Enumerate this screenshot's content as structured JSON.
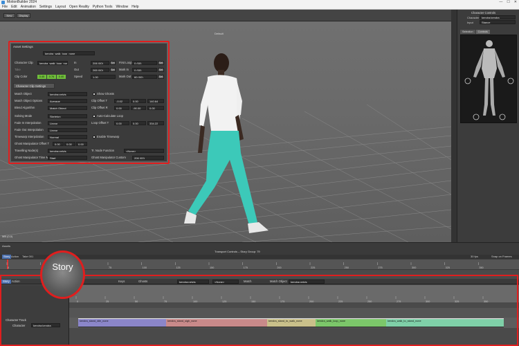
{
  "window": {
    "title": "MotionBuilder 2024",
    "controls": [
      "—",
      "☐",
      "✕"
    ]
  },
  "menu": [
    "File",
    "Edit",
    "Animation",
    "Settings",
    "Layout",
    "Open Reality",
    "Python Tools",
    "Window",
    "Help"
  ],
  "toolbar": {
    "btn1": "New",
    "btn2": "Display"
  },
  "viewport": {
    "label": "Default",
    "bottom_label": "MB (0,0)"
  },
  "asset_settings": {
    "title": "Asset Settings",
    "clip_name": "kendra_walk_loop_none",
    "character_clip_label": "Character Clip",
    "character_clip_value": "kendra_walk_loop_none",
    "in_label": "In",
    "in_value": "206 (00)",
    "out_label": "Out",
    "out_value": "265 (00)",
    "first_loop_label": "First Loop",
    "first_loop_value": "0 (00)",
    "mark_in_label": "Mark In",
    "mark_in_value": "0 (00)",
    "mark_out_label": "Mark Out",
    "mark_out_value": "60 (00)",
    "speed_label": "Speed",
    "speed_value": "1.00",
    "set_label": "Set",
    "take_label": "Take",
    "clip_color_label": "Clip Color",
    "clip_color_values": [
      "0.45",
      "0.76",
      "0.40"
    ],
    "section_tab": "Character Clip Settings",
    "match_object_label": "Match Object",
    "match_object_value": "kendra:pelvis",
    "show_ghosts_label": "Show Ghosts",
    "match_object_options_label": "Match Object Options",
    "match_object_options_value": "Average",
    "clip_offset_t_label": "Clip Offset T",
    "clip_offset_t_values": [
      "-0.02",
      "0.00",
      "140.64"
    ],
    "blend_algorithm_label": "Blend Algorithm",
    "blend_algorithm_value": "Match Object",
    "clip_offset_r_label": "Clip Offset R",
    "clip_offset_r_values": [
      "0.00",
      "-90.00",
      "0.00"
    ],
    "solving_mode_label": "Solving Mode",
    "solving_mode_value": "Skeleton",
    "auto_calc_loop_label": "Auto-Calculate Loop",
    "fade_in_label": "Fade In Interpolation",
    "fade_in_value": "Linear",
    "loop_offset_t_label": "Loop Offset T",
    "loop_offset_t_values": [
      "0.00",
      "0.00",
      "334.22"
    ],
    "fade_out_label": "Fade Out Interpolation",
    "fade_out_value": "Linear",
    "timewarp_label": "Timewarp Interpolation",
    "timewarp_value": "Normal",
    "enable_timewarp_label": "Enable Timewarp",
    "ghost_offset_label": "Ghost Manipulator Offset T",
    "ghost_offset_values": [
      "0.00",
      "0.00",
      "0.00"
    ],
    "travelling_node_label": "Travelling Node(s)",
    "travelling_node_value": "kendra:pelvis",
    "tr_node_function_label": "Tr. Node Function",
    "tr_node_function_value": "<None>",
    "ghost_time_label": "Ghost Manipulator Time Mc",
    "ghost_time_value": "Start",
    "ghost_custom_label": "Ghost Manipulator Custom",
    "ghost_custom_value": "206 (00)"
  },
  "right_panel": {
    "title": "Character Controls",
    "character_label": "Character",
    "character_value": "kendra:kendra",
    "input_label": "Input",
    "input_value": "Stance",
    "tabs": [
      "Selection",
      "Controls"
    ]
  },
  "transport": {
    "title": "Transport Controls – Story Group: 79",
    "fps": "30 fps",
    "snap_label": "Snap on Frames",
    "tabs": [
      "Story",
      "Action",
      "Take 001"
    ],
    "frame_ticks": [
      "0",
      "25",
      "50",
      "75",
      "100",
      "125",
      "150",
      "175",
      "200",
      "225",
      "250",
      "275",
      "300",
      "325",
      "350"
    ]
  },
  "story": {
    "callout": "Story",
    "tabs": [
      "Story",
      "Action"
    ],
    "keys_label": "Keys",
    "ghosts_label": "Ghosts",
    "object_value": "kendra:pelvis",
    "none_value": "<None>",
    "match_label": "Match",
    "match_object_label": "Match Object",
    "match_object_value": "kendra:pelvis",
    "ruler_ticks": [
      "0",
      "25",
      "50",
      "75",
      "100",
      "125",
      "150",
      "175",
      "200",
      "225",
      "250",
      "275",
      "300",
      "325",
      "350"
    ],
    "track_label": "Character Track",
    "character_label": "Character",
    "character_value": "kendra:kendra",
    "clips": [
      {
        "name": "kendra_stand_idle_none",
        "color": "#8b86c9"
      },
      {
        "name": "kendra_stand_sigh_none",
        "color": "#c98a8a"
      },
      {
        "name": "kendra_stand_to_walk_none",
        "color": "#c9c08a"
      },
      {
        "name": "kendra_walk_loop_none",
        "color": "#7cc76a"
      },
      {
        "name": "kendra_walk_to_stand_none",
        "color": "#7fd0a8"
      }
    ]
  }
}
